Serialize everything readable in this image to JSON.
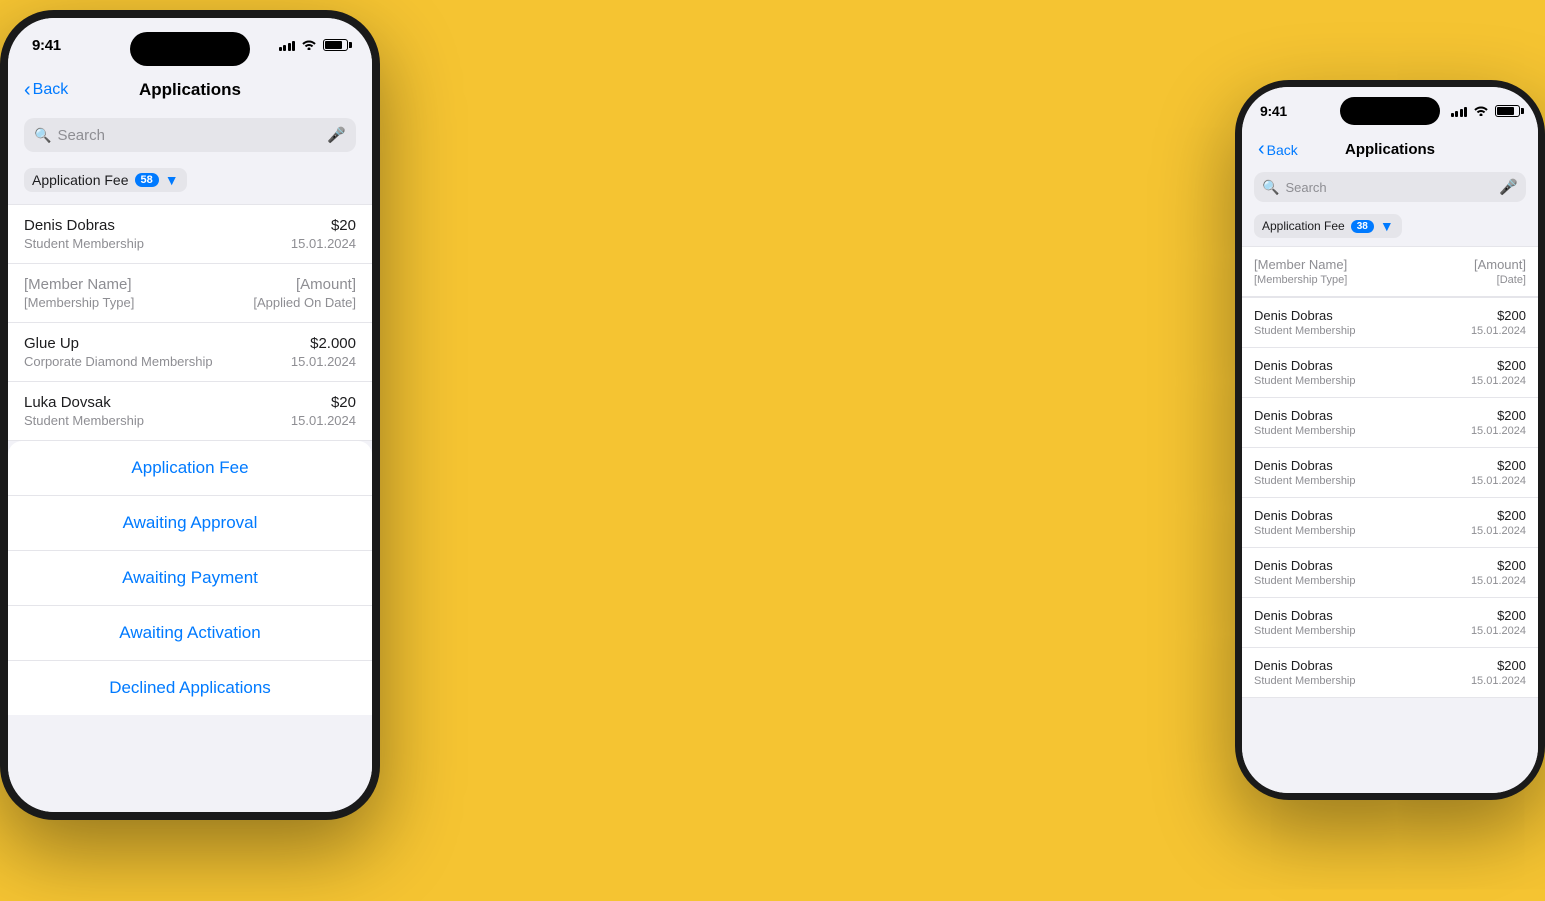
{
  "background": "#F5C432",
  "phone1": {
    "status": {
      "time": "9:41",
      "signal_bars": [
        4,
        6,
        8,
        10,
        12
      ],
      "wifi": "wifi",
      "battery": "battery"
    },
    "nav": {
      "back_label": "Back",
      "title": "Applications"
    },
    "search": {
      "placeholder": "Search"
    },
    "filter": {
      "label": "Application Fee",
      "badge": "58"
    },
    "list_items": [
      {
        "name": "Denis Dobras",
        "type": "Student Membership",
        "amount": "$20",
        "date": "15.01.2024"
      },
      {
        "name": "[Member Name]",
        "type": "[Membership Type]",
        "amount": "[Amount]",
        "date": "[Applied On Date]"
      },
      {
        "name": "Glue Up",
        "type": "Corporate Diamond Membership",
        "amount": "$2.000",
        "date": "15.01.2024"
      },
      {
        "name": "Luka Dovsak",
        "type": "Student Membership",
        "amount": "$20",
        "date": "15.01.2024"
      }
    ],
    "action_sheet": {
      "items": [
        "Application Fee",
        "Awaiting Approval",
        "Awaiting Payment",
        "Awaiting Activation",
        "Declined Applications"
      ]
    }
  },
  "phone2": {
    "status": {
      "time": "9:41",
      "signal_bars": [
        4,
        6,
        8,
        10,
        12
      ],
      "wifi": "wifi",
      "battery": "battery"
    },
    "nav": {
      "back_label": "Back",
      "title": "Applications"
    },
    "search": {
      "placeholder": "Search"
    },
    "filter": {
      "label": "Application Fee",
      "badge": "38"
    },
    "list_header": {
      "name": "[Member Name]",
      "type": "[Membership Type]",
      "amount": "[Amount]",
      "date": "[Date]"
    },
    "list_items": [
      {
        "name": "Denis Dobras",
        "type": "Student Membership",
        "amount": "$200",
        "date": "15.01.2024"
      },
      {
        "name": "Denis Dobras",
        "type": "Student Membership",
        "amount": "$200",
        "date": "15.01.2024"
      },
      {
        "name": "Denis Dobras",
        "type": "Student Membership",
        "amount": "$200",
        "date": "15.01.2024"
      },
      {
        "name": "Denis Dobras",
        "type": "Student Membership",
        "amount": "$200",
        "date": "15.01.2024"
      },
      {
        "name": "Denis Dobras",
        "type": "Student Membership",
        "amount": "$200",
        "date": "15.01.2024"
      },
      {
        "name": "Denis Dobras",
        "type": "Student Membership",
        "amount": "$200",
        "date": "15.01.2024"
      },
      {
        "name": "Denis Dobras",
        "type": "Student Membership",
        "amount": "$200",
        "date": "15.01.2024"
      },
      {
        "name": "Denis Dobras",
        "type": "Student Membership",
        "amount": "$200",
        "date": "15.01.2024"
      }
    ]
  }
}
